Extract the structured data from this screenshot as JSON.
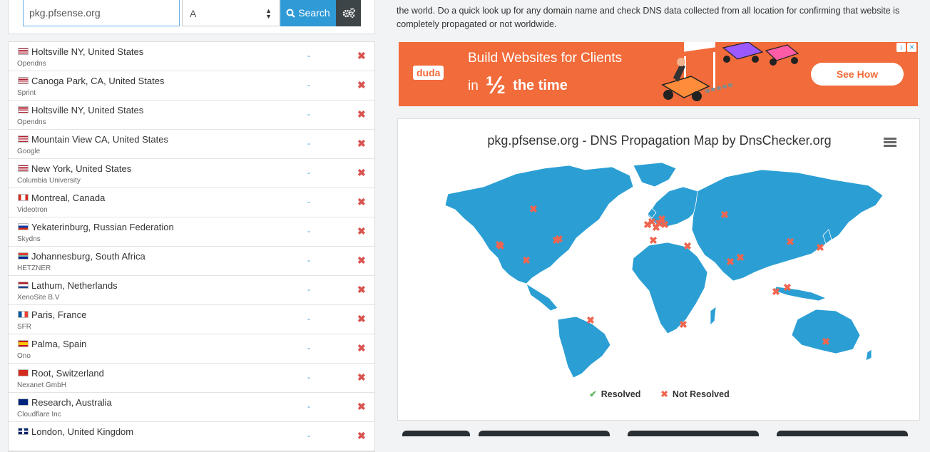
{
  "search": {
    "query": "pkg.pfsense.org",
    "record_type": "A",
    "button_label": "Search"
  },
  "results": [
    {
      "location": "Holtsville NY, United States",
      "provider": "Opendns",
      "value": "-",
      "flag": "us"
    },
    {
      "location": "Canoga Park, CA, United States",
      "provider": "Sprint",
      "value": "-",
      "flag": "us"
    },
    {
      "location": "Holtsville NY, United States",
      "provider": "Opendns",
      "value": "-",
      "flag": "us"
    },
    {
      "location": "Mountain View CA, United States",
      "provider": "Google",
      "value": "-",
      "flag": "us"
    },
    {
      "location": "New York, United States",
      "provider": "Columbia University",
      "value": "-",
      "flag": "us"
    },
    {
      "location": "Montreal, Canada",
      "provider": "Videotron",
      "value": "-",
      "flag": "ca"
    },
    {
      "location": "Yekaterinburg, Russian Federation",
      "provider": "Skydns",
      "value": "-",
      "flag": "ru"
    },
    {
      "location": "Johannesburg, South Africa",
      "provider": "HETZNER",
      "value": "-",
      "flag": "za"
    },
    {
      "location": "Lathum, Netherlands",
      "provider": "XenoSite B.V",
      "value": "-",
      "flag": "nl"
    },
    {
      "location": "Paris, France",
      "provider": "SFR",
      "value": "-",
      "flag": "fr"
    },
    {
      "location": "Palma, Spain",
      "provider": "Ono",
      "value": "-",
      "flag": "es"
    },
    {
      "location": "Root, Switzerland",
      "provider": "Nexanet GmbH",
      "value": "-",
      "flag": "ch"
    },
    {
      "location": "Research, Australia",
      "provider": "Cloudflare Inc",
      "value": "-",
      "flag": "au"
    },
    {
      "location": "London, United Kingdom",
      "provider": "",
      "value": "-",
      "flag": "gb"
    }
  ],
  "description": "the world. Do a quick look up for any domain name and check DNS data collected from all location for confirming that website is completely propagated or not worldwide.",
  "ad": {
    "brand": "duda",
    "headline_1": "Build Websites for Clients",
    "headline_in": "in",
    "headline_fraction": "½",
    "headline_2": "the time",
    "cta": "See How"
  },
  "map": {
    "title": "pkg.pfsense.org - DNS Propagation Map by DnsChecker.org",
    "legend_resolved": "Resolved",
    "legend_not_resolved": "Not Resolved",
    "land_color": "#2b9fd4",
    "marker_color": "#f0654f"
  },
  "colors": {
    "accent": "#2e9ad6",
    "error": "#d9534f",
    "ad_bg": "#f26b3a"
  }
}
